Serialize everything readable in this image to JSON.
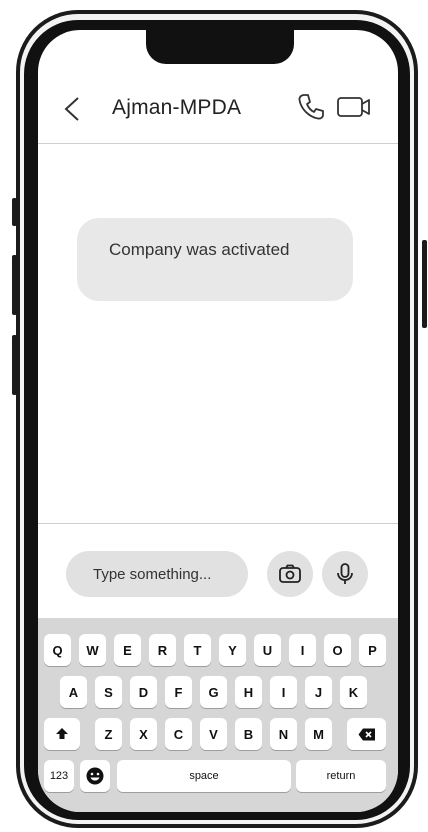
{
  "chat": {
    "contact_name": "Ajman-MPDA",
    "message": "Company was activated"
  },
  "composer": {
    "placeholder": "Type something..."
  },
  "keyboard": {
    "row1": [
      "Q",
      "W",
      "E",
      "R",
      "T",
      "Y",
      "U",
      "I",
      "O",
      "P"
    ],
    "row2": [
      "A",
      "S",
      "D",
      "F",
      "G",
      "H",
      "I",
      "J",
      "K"
    ],
    "row3": [
      "Z",
      "X",
      "C",
      "V",
      "B",
      "N",
      "M"
    ],
    "numbers_label": "123",
    "space_label": "space",
    "return_label": "return"
  },
  "icons": [
    "back-icon",
    "phone-icon",
    "video-icon",
    "camera-icon",
    "microphone-icon",
    "shift-icon",
    "emoji-icon",
    "backspace-icon"
  ],
  "colors": {
    "bubble": "#e8e8e8",
    "keyboard": "#d6d6d6",
    "input": "#e1e1e1"
  }
}
